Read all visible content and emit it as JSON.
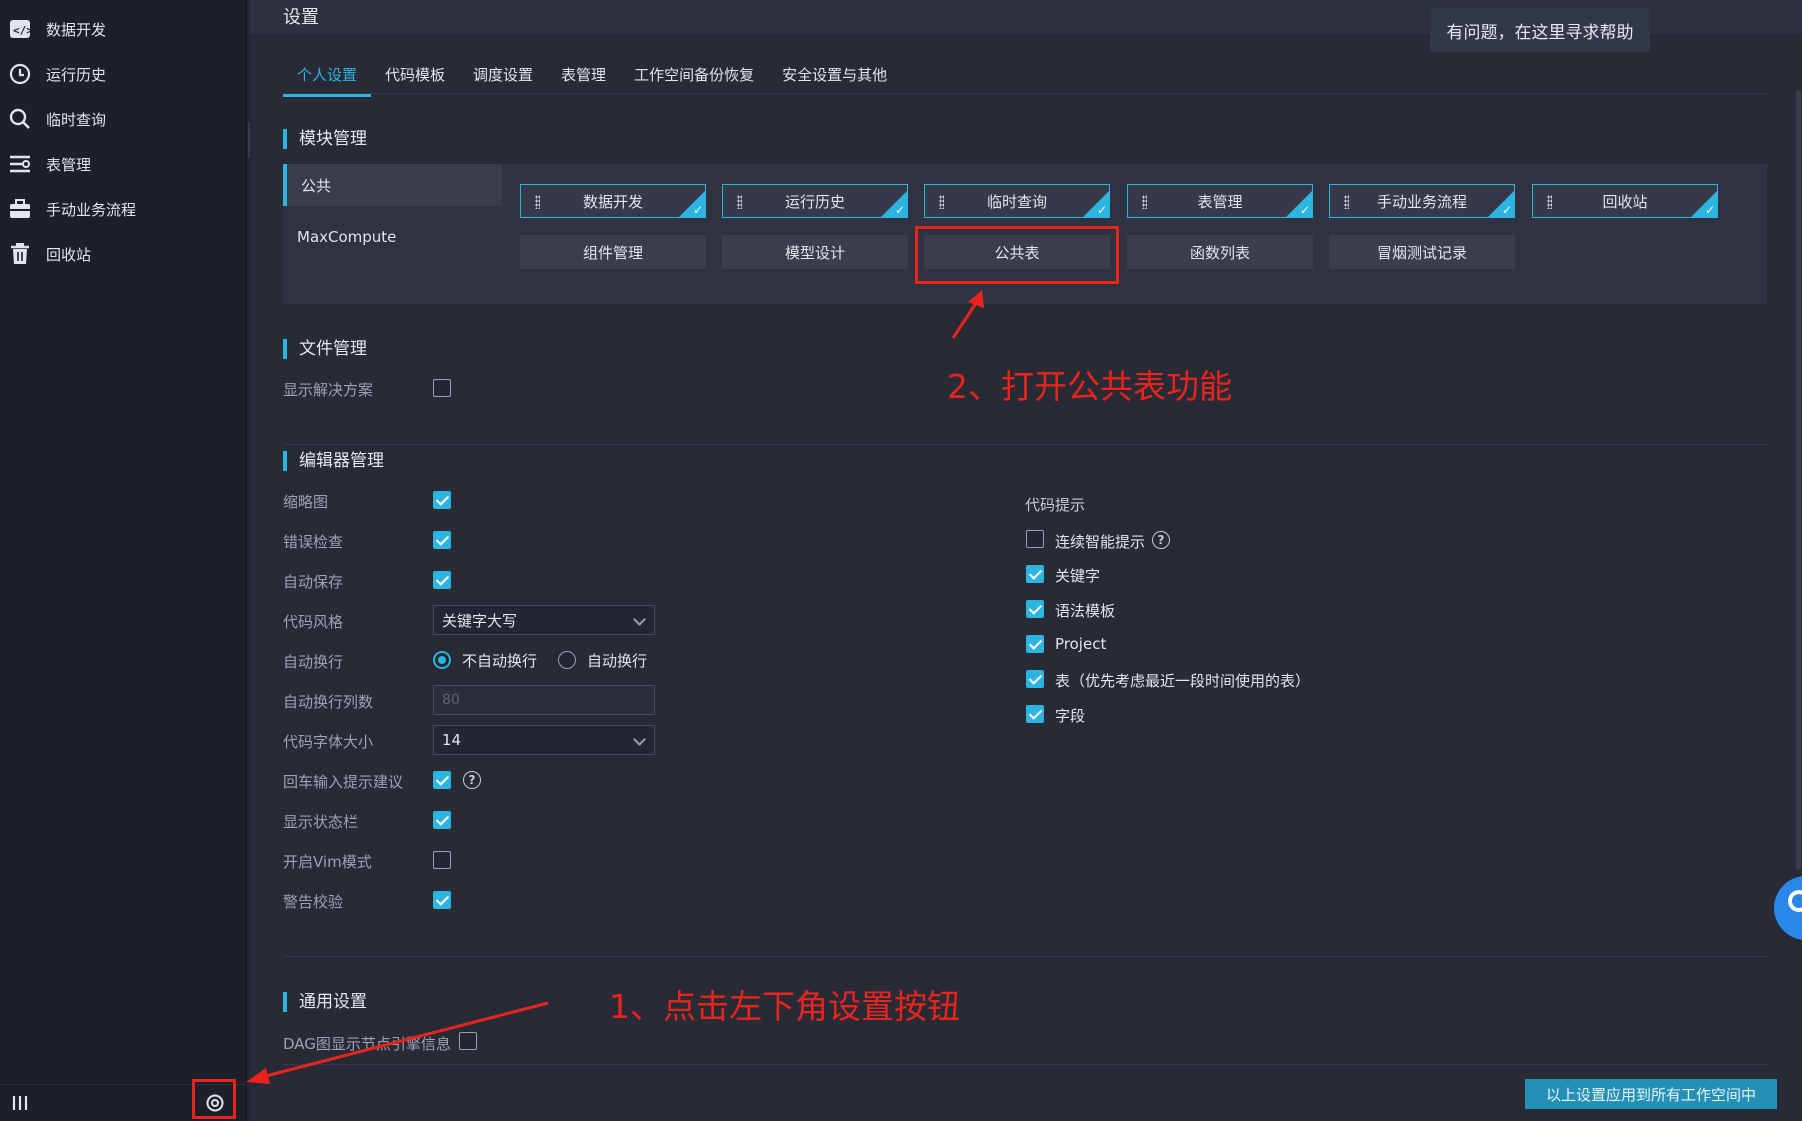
{
  "sidebar": {
    "items": [
      {
        "label": "数据开发",
        "icon": "code-icon"
      },
      {
        "label": "运行历史",
        "icon": "clock-icon"
      },
      {
        "label": "临时查询",
        "icon": "search-icon"
      },
      {
        "label": "表管理",
        "icon": "table-list-icon"
      },
      {
        "label": "手动业务流程",
        "icon": "briefcase-icon"
      },
      {
        "label": "回收站",
        "icon": "trash-icon"
      }
    ]
  },
  "header": {
    "title": "设置",
    "help": "有问题，在这里寻求帮助"
  },
  "tabs": [
    "个人设置",
    "代码模板",
    "调度设置",
    "表管理",
    "工作空间备份恢复",
    "安全设置与其他"
  ],
  "module_mgmt": {
    "title": "模块管理",
    "categories": [
      "公共",
      "MaxCompute"
    ],
    "row1": [
      "数据开发",
      "运行历史",
      "临时查询",
      "表管理",
      "手动业务流程",
      "回收站"
    ],
    "row2": [
      "组件管理",
      "模型设计",
      "公共表",
      "函数列表",
      "冒烟测试记录"
    ]
  },
  "file_mgmt": {
    "title": "文件管理",
    "show_solution": "显示解决方案"
  },
  "editor_mgmt": {
    "title": "编辑器管理",
    "labels": {
      "minimap": "缩略图",
      "error_check": "错误检查",
      "autosave": "自动保存",
      "code_style": "代码风格",
      "auto_wrap": "自动换行",
      "wrap_cols": "自动换行列数",
      "font_size": "代码字体大小",
      "enter_suggest": "回车输入提示建议",
      "status_bar": "显示状态栏",
      "vim_mode": "开启Vim模式",
      "warn_check": "警告校验"
    },
    "code_style_value": "关键字大写",
    "wrap_options": [
      "不自动换行",
      "自动换行"
    ],
    "wrap_cols_placeholder": "80",
    "font_size_value": "14",
    "hint_title": "代码提示",
    "hints": [
      "连续智能提示",
      "关键字",
      "语法模板",
      "Project",
      "表（优先考虑最近一段时间使用的表）",
      "字段"
    ]
  },
  "general": {
    "title": "通用设置",
    "dag": "DAG图显示节点引擎信息"
  },
  "apply_button": "以上设置应用到所有工作空间中",
  "annotations": {
    "step1": "1、点击左下角设置按钮",
    "step2": "2、打开公共表功能"
  },
  "colors": {
    "accent": "#2bb5e0",
    "annotation": "#e8241d"
  }
}
